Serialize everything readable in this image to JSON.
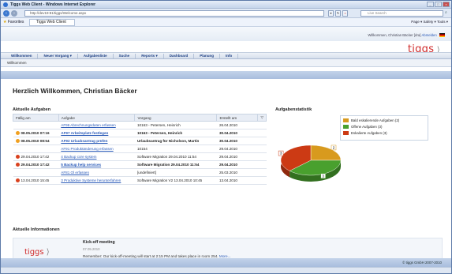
{
  "window": {
    "title": "Tiggs Web Client - Windows Internet Explorer"
  },
  "browser": {
    "url": "http://dev19:81/tiggs/Welcome.aspx",
    "search_placeholder": "Live Search",
    "favorites_label": "Favorites",
    "tab_label": "Tiggs Web Client",
    "tools_menu": "Page ▾  Safety ▾  Tools ▾"
  },
  "app": {
    "user_line": "Willkommen, Christian Bäcker [dra]",
    "logout": "Abmelden",
    "logo": "tiggs",
    "menu": [
      "Willkommen",
      "Neuer Vorgang ▾",
      "Aufgabenliste",
      "Suche",
      "Reports ▾",
      "Dashboard",
      "Planung",
      "Info"
    ],
    "breadcrumb": "Willkommen",
    "welcome": "Herzlich Willkommen, Christian Bäcker"
  },
  "tasks": {
    "title": "Aktuelle Aufgaben",
    "columns": [
      "Fällig am",
      "Aufgabe",
      "Vorgang",
      "Erstellt am"
    ],
    "rows": [
      {
        "due": "",
        "task": "AF96 Abrechnungsdaten erfassen",
        "process": "10163 - Petersen, Heinrich",
        "created": "26.04.2010",
        "bold": false,
        "status": ""
      },
      {
        "due": "08.05.2010 07:16",
        "task": "AF97 Arbeitsplatz festlegen",
        "process": "10163 - Petersen, Heinrich",
        "created": "30.04.2010",
        "bold": true,
        "status": "orange"
      },
      {
        "due": "08.05.2010 08:54",
        "task": "AF92 Urlaubsantrag prüfen",
        "process": "Urlaubsantrag für Nicholson, Martin",
        "created": "30.04.2010",
        "bold": true,
        "status": "orange"
      },
      {
        "due": "",
        "task": "AF91 Produktänderung erfassen",
        "process": "10154",
        "created": "29.04.2010",
        "bold": false,
        "status": ""
      },
      {
        "due": "29.04.2010 17:42",
        "task": "4 Backup core system",
        "process": "Software Migration 29.04.2010 11:54",
        "created": "29.04.2010",
        "bold": false,
        "status": "red"
      },
      {
        "due": "29.04.2010 17:42",
        "task": "5 Backup help services",
        "process": "Software Migration 29.04.2010 11:54",
        "created": "29.04.2010",
        "bold": true,
        "status": "red"
      },
      {
        "due": "",
        "task": "AF81 Ol erfassen",
        "process": "[undefiniert]",
        "created": "25.03.2010",
        "bold": false,
        "status": ""
      },
      {
        "due": "13.04.2010 15:45",
        "task": "3 Produktive Systeme herunterfahren",
        "process": "Software Migration V2 13.04.2010 10:45",
        "created": "13.04.2010",
        "bold": false,
        "status": "red"
      }
    ]
  },
  "stats": {
    "title": "Aufgabenstatistik",
    "chart_data": {
      "type": "pie",
      "categories": [
        "Bald eskalierende Aufgaben",
        "Offene Aufgaben",
        "Eskalierte Aufgaben"
      ],
      "values": [
        2,
        3,
        3
      ],
      "colors": [
        "#d89a1e",
        "#49a02e",
        "#cc3a14"
      ],
      "legend": [
        "Bald eskalierende Aufgaben (2)",
        "Offene Aufgaben (3)",
        "Eskalierte Aufgaben (3)"
      ],
      "value_labels": [
        "2",
        "3",
        "3"
      ]
    }
  },
  "news": {
    "title": "Aktuelle Informationen",
    "logo": "tiggs",
    "item_title": "Kick-off meeting",
    "item_date": "07.05.2010",
    "item_body": "Remember: Our kick-off-meeting will start at 2:15 PM and takes place in room 254.",
    "more": "More..."
  },
  "footer": "© tiggs GmbH 2007-2010"
}
